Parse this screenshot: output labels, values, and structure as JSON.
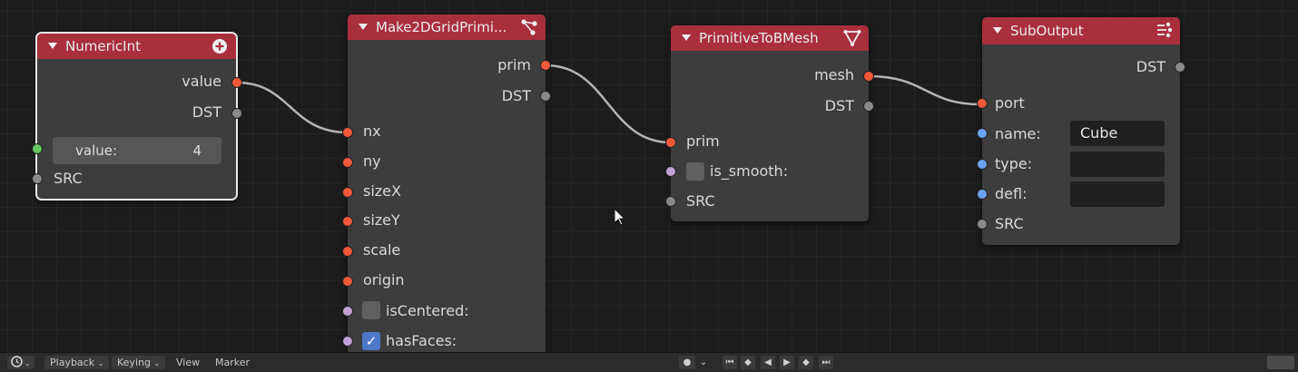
{
  "nodes": {
    "numeric_int": {
      "title": "NumericInt",
      "icon": "plus-circle-icon",
      "outputs": [
        "value",
        "DST"
      ],
      "field_label": "value:",
      "field_value": "4",
      "input": "SRC"
    },
    "make_grid": {
      "title": "Make2DGridPrimi...",
      "icon": "graph-nodes-icon",
      "outputs": [
        "prim",
        "DST"
      ],
      "inputs": [
        "nx",
        "ny",
        "sizeX",
        "sizeY",
        "scale",
        "origin"
      ],
      "checkbox1": "isCentered:",
      "checkbox2": "hasFaces:"
    },
    "prim_to_bmesh": {
      "title": "PrimitiveToBMesh",
      "icon": "funnel-mesh-icon",
      "outputs": [
        "mesh",
        "DST"
      ],
      "inputs": [
        "prim"
      ],
      "checkbox": "is_smooth:",
      "src": "SRC"
    },
    "sub_output": {
      "title": "SubOutput",
      "icon": "output-icon",
      "output": "DST",
      "port": "port",
      "name_label": "name:",
      "name_value": "Cube",
      "type_label": "type:",
      "type_value": "",
      "defl_label": "defl:",
      "defl_value": "",
      "src": "SRC"
    }
  },
  "timeline": {
    "menu": [
      "Playback",
      "Keying",
      "View",
      "Marker"
    ],
    "controls": [
      "jump-start-icon",
      "prev-keyframe-icon",
      "play-reverse-icon",
      "play-icon",
      "next-keyframe-icon",
      "jump-end-icon"
    ]
  },
  "colors": {
    "header": "#a92f3d",
    "node_body": "#3d3d3d",
    "socket_orange": "#f0583a",
    "socket_gray": "#8a8a8a",
    "socket_blue": "#6ba3f0",
    "socket_purple": "#c3a0d6",
    "socket_green": "#63c763",
    "link": "#b4b4b4"
  }
}
